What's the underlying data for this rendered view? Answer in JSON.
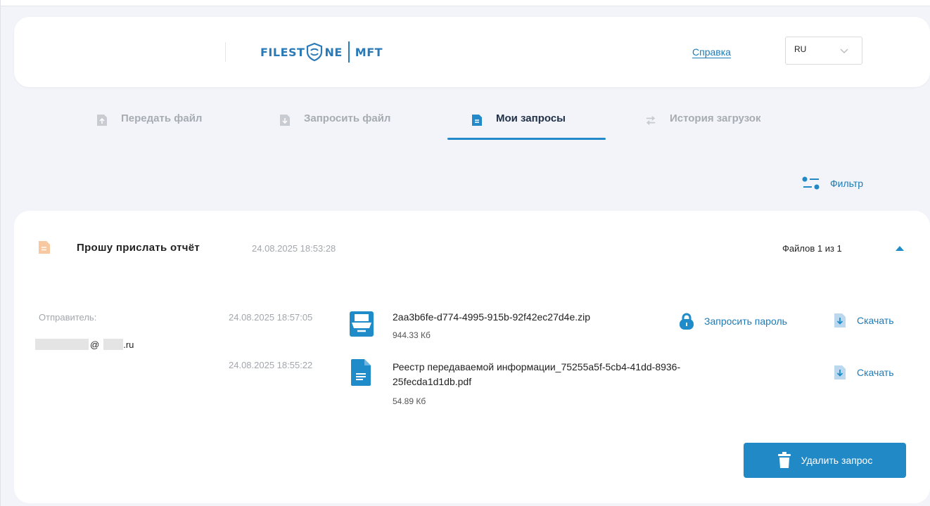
{
  "header": {
    "logo_left": "FILEST",
    "logo_mid": "NE",
    "logo_right": "MFT",
    "help_link": "Справка",
    "language": "RU"
  },
  "tabs": [
    {
      "label": "Передать файл",
      "icon": "upload-icon",
      "active": false
    },
    {
      "label": "Запросить файл",
      "icon": "download-icon",
      "active": false
    },
    {
      "label": "Мои запросы",
      "icon": "document-icon",
      "active": true
    },
    {
      "label": "История загрузок",
      "icon": "transfer-icon",
      "active": false
    }
  ],
  "filter_label": "Фильтр",
  "request": {
    "title": "Прошу прислать отчёт",
    "date": "24.08.2025 18:53:28",
    "files_count": "Файлов 1 из 1",
    "sender_label": "Отправитель:",
    "sender_email_at": "@",
    "sender_email_suffix": ".ru",
    "files": [
      {
        "date": "24.08.2025 18:57:05",
        "name": "2aa3b6fe-d774-4995-915b-92f42ec27d4e.zip",
        "size": "944.33 Кб",
        "icon": "archive-icon",
        "request_password": "Запросить пароль",
        "download": "Скачать"
      },
      {
        "date": "24.08.2025 18:55:22",
        "name_line1": "Реестр передаваемой информации_75255a5f-5cb4-41dd-8936-",
        "name_line2": "25fecda1d1db.pdf",
        "size": "54.89 Кб",
        "icon": "pdf-file-icon",
        "download": "Скачать"
      }
    ],
    "delete_label": "Удалить запрос"
  },
  "colors": {
    "accent": "#2189c5",
    "link": "#1b7bb7",
    "background": "#f2f4f9",
    "request_icon": "#f5a96a"
  }
}
